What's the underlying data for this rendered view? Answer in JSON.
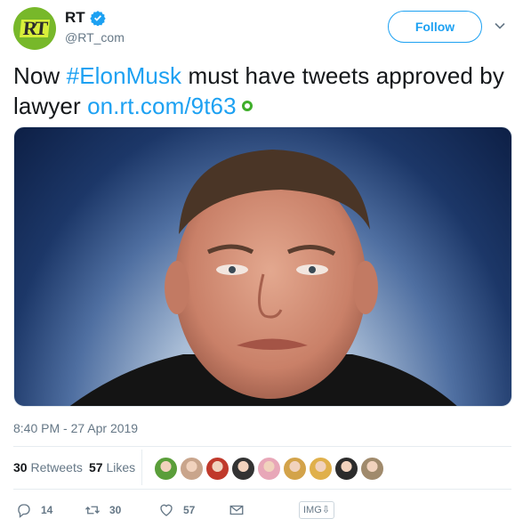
{
  "header": {
    "display_name": "RT",
    "handle": "@RT_com",
    "follow_label": "Follow",
    "avatar_icon": "rt-logo-icon",
    "verified_icon": "verified-badge-icon"
  },
  "tweet": {
    "text_before": "Now ",
    "hashtag": "#ElonMusk",
    "text_after": " must have tweets approved by lawyer ",
    "link": "on.rt.com/9t63"
  },
  "meta": {
    "timestamp": "8:40 PM - 27 Apr 2019"
  },
  "stats": {
    "retweets_count": "30",
    "retweets_label": "Retweets",
    "likes_count": "57",
    "likes_label": "Likes",
    "liker_avatar_colors": [
      "#5a9e3a",
      "#c9a58c",
      "#c0392b",
      "#333333",
      "#e8a7b8",
      "#d3a34a",
      "#e0b04b",
      "#2c2c2c",
      "#a08a6c"
    ]
  },
  "actions": {
    "reply_count": "14",
    "retweet_count": "30",
    "like_count": "57",
    "img_label": "IMG⇩"
  },
  "colors": {
    "accent": "#1da1f2",
    "muted": "#657786",
    "avatar_bg": "#77b82a"
  }
}
